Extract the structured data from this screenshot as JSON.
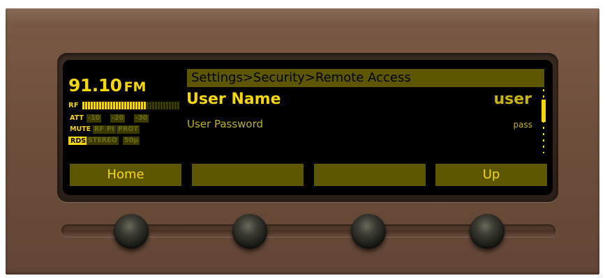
{
  "status": {
    "frequency": "91.10",
    "band": "FM",
    "rf_label": "RF",
    "rf_level": 0.65,
    "att_label": "ATT",
    "att_options": [
      "-10",
      "-20",
      "-30"
    ],
    "mute_label": "MUTE",
    "indicators": [
      "RF",
      "PI",
      "PROT"
    ],
    "rds_label": "RDS",
    "stereo_label": "STEREO",
    "deemphasis": "50μ"
  },
  "breadcrumb": "Settings>Security>Remote Access",
  "menu": {
    "selected": {
      "label": "User Name",
      "value": "user"
    },
    "next": {
      "label": "User Password",
      "value": "pass"
    }
  },
  "softkeys": [
    "Home",
    "",
    "",
    "Up"
  ],
  "colors": {
    "accent": "#f5d60a",
    "dim_bar": "#5c5600",
    "panel": "#6e4f3c",
    "screen": "#000000"
  }
}
